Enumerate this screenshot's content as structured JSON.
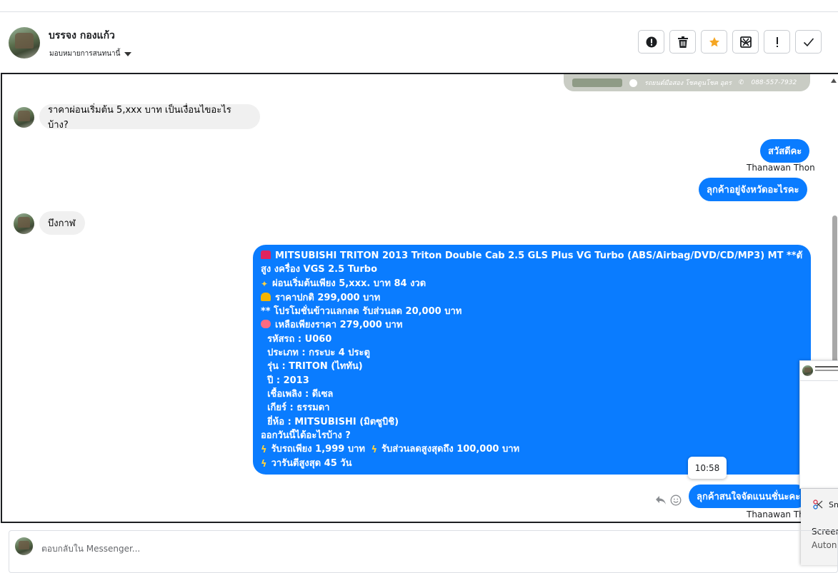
{
  "header": {
    "contact_name": "บรรจง กองแก้ว",
    "assign_label": "มอบหมายการสนทนานี้",
    "tools": [
      {
        "name": "report-button",
        "icon": "alert-circle-icon"
      },
      {
        "name": "delete-button",
        "icon": "trash-icon"
      },
      {
        "name": "star-button",
        "icon": "star-icon",
        "color": "#f5a623"
      },
      {
        "name": "spam-button",
        "icon": "mail-x-icon"
      },
      {
        "name": "mark-important-button",
        "icon": "exclamation-icon"
      },
      {
        "name": "done-button",
        "icon": "check-icon"
      }
    ]
  },
  "banner": {
    "page_name": "รถยนต์มือสอง โชคดูนโชค อุดร",
    "phone": "088-557-7932"
  },
  "messages": {
    "in_1": "ราคาผ่อนเริ่มต้น 5,xxx บาท เป็นเงื่อนไขอะไรบ้าง?",
    "out_1": "สวัสดีคะ",
    "out_1_sender": "Thanawan Thon",
    "out_2": "ลุกค้าอยู่จังหวัดอะไรคะ",
    "in_2": "บึงกาฬ",
    "long_lines": [
      "MITSUBISHI TRITON 2013 Triton Double Cab 2.5 GLS Plus VG Turbo (ABS/Airbag/DVD/CD/MP3) MT **ตัวท็อป รุ่น ยก",
      "สูง งครื่อง VGS 2.5 Turbo",
      "ผ่อนเริ่มต้นเพียง 5,xxx. บาท 84 งวด",
      "ราคาปกติ 299,000 บาท",
      "** โปรโมชั่นข้าวแลกลด รับส่วนลด 20,000 บาท",
      "เหลือเพียงราคา 279,000 บาท",
      "รหัสรถ : U060",
      "ประเภท : กระบะ 4 ประตู",
      "รุ่น : TRITON (ไททัน)",
      "ปี : 2013",
      "เชื้อเพลิง : ดีเซล",
      "เกียร์ : ธรรมดา",
      "ยี่ห้อ : MITSUBISHI (มิตซูบิชิ)",
      "ออกวันนี้ได้อะไรบ้าง ?",
      "รับรถเพียง 1,999 บาท",
      "รับส่วนลดสูงสุดถึง 100,000 บาท",
      "วารันตีสูงสุด 45 วัน"
    ],
    "tooltip_time": "10:58",
    "out_3": "ลุกค้าสนใจจัดแนนชั่นะคะ",
    "out_3_sender": "Thanawan Thon"
  },
  "colors": {
    "outgoing": "#0a7cff",
    "incoming": "#f0f0f0"
  },
  "notification": {
    "app_name": "Sn",
    "line1": "Screer",
    "line2": "Auton"
  },
  "composer": {
    "placeholder": "ตอบกลับใน Messenger..."
  }
}
